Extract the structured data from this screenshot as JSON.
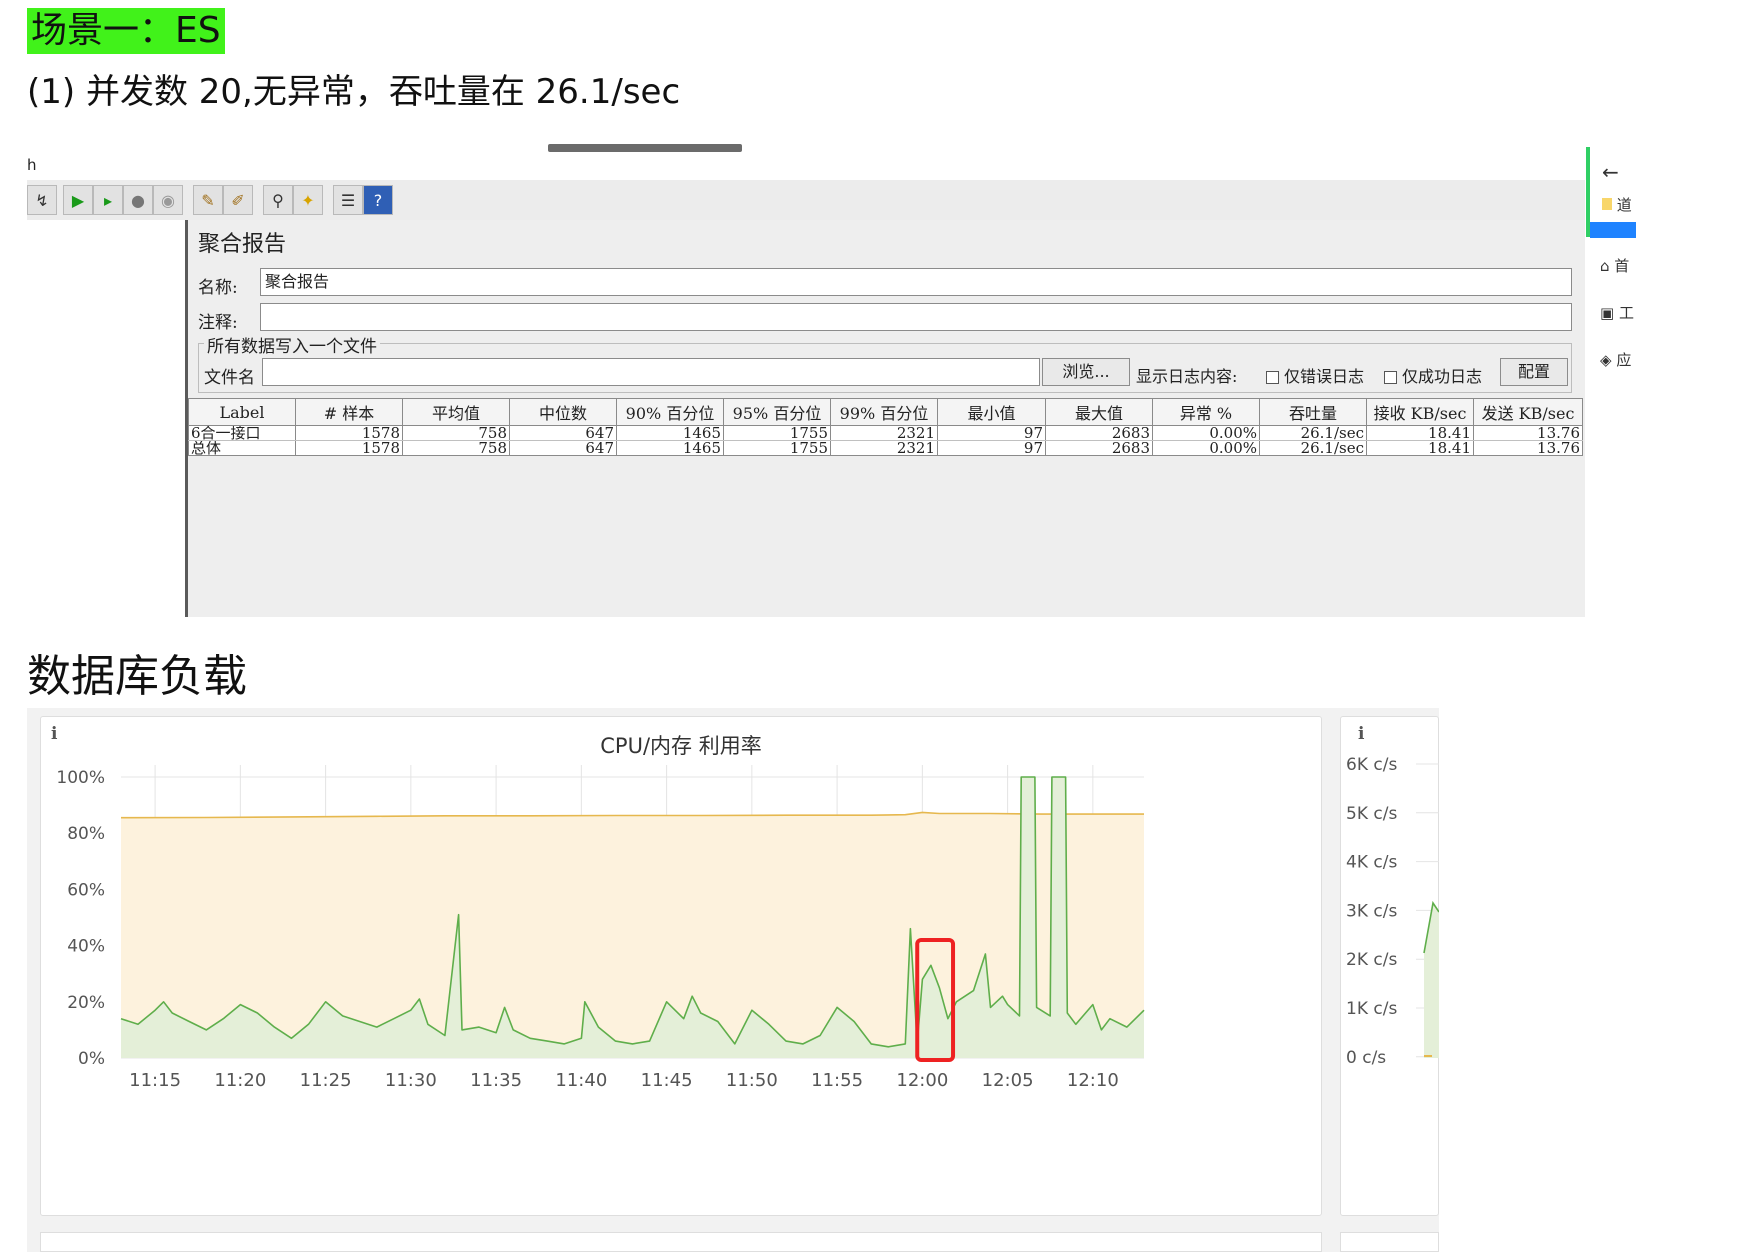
{
  "doc": {
    "scene_title": "场景一：ES",
    "subline": "(1)    并发数 20,无异常，吞吐量在 26.1/sec",
    "db_section_title": "数据库负载"
  },
  "jmeter": {
    "window_title_fragment": "h",
    "toolbar_icons": [
      "remote-start-icon",
      "start-icon",
      "start-no-pause-icon",
      "stop-icon",
      "shutdown-icon",
      "clear-icon",
      "clear-all-icon",
      "search-icon",
      "reset-search-icon",
      "function-helper-icon",
      "help-icon"
    ],
    "panel_title": "聚合报告",
    "name_label": "名称:",
    "name_value": "聚合报告",
    "comment_label": "注释:",
    "comment_value": "",
    "file_group_legend": "所有数据写入一个文件",
    "filename_label": "文件名",
    "filename_value": "",
    "browse_button": "浏览...",
    "log_display_label": "显示日志内容:",
    "errors_only_label": "仅错误日志",
    "success_only_label": "仅成功日志",
    "config_button": "配置",
    "errors_only_checked": false,
    "success_only_checked": false,
    "table": {
      "headers": [
        "Label",
        "# 样本",
        "平均值",
        "中位数",
        "90% 百分位",
        "95% 百分位",
        "99% 百分位",
        "最小值",
        "最大值",
        "异常 %",
        "吞吐量",
        "接收 KB/sec",
        "发送 KB/sec"
      ],
      "rows": [
        [
          "6合一接口",
          "1578",
          "758",
          "647",
          "1465",
          "1755",
          "2321",
          "97",
          "2683",
          "0.00%",
          "26.1/sec",
          "18.41",
          "13.76"
        ],
        [
          "总体",
          "1578",
          "758",
          "647",
          "1465",
          "1755",
          "2321",
          "97",
          "2683",
          "0.00%",
          "26.1/sec",
          "18.41",
          "13.76"
        ]
      ]
    }
  },
  "browser_side": {
    "items": [
      {
        "icon": "back-arrow-icon",
        "label": "←"
      },
      {
        "icon": "note-icon",
        "label": "道"
      },
      {
        "icon": "home-icon",
        "label": "首"
      },
      {
        "icon": "tool-icon",
        "label": "工"
      },
      {
        "icon": "app-icon",
        "label": "应"
      }
    ],
    "accent_green": "#2fcf64",
    "accent_blue": "#1f83ff"
  },
  "grafana": {
    "info_glyph": "i",
    "panel_right_ticks": [
      "6K c/s",
      "5K c/s",
      "4K c/s",
      "3K c/s",
      "2K c/s",
      "1K c/s",
      "0 c/s"
    ]
  },
  "chart_data": {
    "type": "area",
    "title": "CPU/内存 利用率",
    "xlabel": "",
    "ylabel": "",
    "ylim": [
      0,
      100
    ],
    "y_ticks": [
      "100%",
      "80%",
      "60%",
      "40%",
      "20%",
      "0%"
    ],
    "x_ticks": [
      "11:15",
      "11:20",
      "11:25",
      "11:30",
      "11:35",
      "11:40",
      "11:45",
      "11:50",
      "11:55",
      "12:00",
      "12:05",
      "12:10"
    ],
    "x_range": [
      "11:13",
      "12:13"
    ],
    "grid": true,
    "legend": "none",
    "highlight_box": {
      "from": "11:59.7",
      "to": "12:01.8",
      "color": "#ee2222"
    },
    "series": [
      {
        "color": "#e6b84e",
        "fill": "#fdf2dd",
        "points": [
          [
            "11:13",
            85.5
          ],
          [
            "11:18",
            85.6
          ],
          [
            "11:23",
            85.8
          ],
          [
            "11:28",
            86.0
          ],
          [
            "11:32",
            86.2
          ],
          [
            "11:37",
            86.2
          ],
          [
            "11:42",
            86.3
          ],
          [
            "11:47",
            86.3
          ],
          [
            "11:52",
            86.4
          ],
          [
            "11:57",
            86.4
          ],
          [
            "11:59",
            86.6
          ],
          [
            "12:00",
            87.4
          ],
          [
            "12:01",
            87.0
          ],
          [
            "12:04",
            87.0
          ],
          [
            "12:07",
            86.8
          ],
          [
            "12:13",
            86.8
          ]
        ]
      },
      {
        "color": "#5fae4b",
        "fill": "#e4efd8",
        "points": [
          [
            "11:13",
            14
          ],
          [
            "11:14",
            12
          ],
          [
            "11:15",
            17
          ],
          [
            "11:15.5",
            20
          ],
          [
            "11:16",
            16
          ],
          [
            "11:17",
            13
          ],
          [
            "11:18",
            10
          ],
          [
            "11:19",
            14
          ],
          [
            "11:20",
            19
          ],
          [
            "11:21",
            16
          ],
          [
            "11:22",
            11
          ],
          [
            "11:23",
            7
          ],
          [
            "11:24",
            12
          ],
          [
            "11:25",
            20
          ],
          [
            "11:26",
            15
          ],
          [
            "11:27",
            13
          ],
          [
            "11:28",
            11
          ],
          [
            "11:29",
            14
          ],
          [
            "11:30",
            17
          ],
          [
            "11:30.5",
            21
          ],
          [
            "11:31",
            12
          ],
          [
            "11:32",
            8
          ],
          [
            "11:32.8",
            51
          ],
          [
            "11:33",
            10
          ],
          [
            "11:34",
            11
          ],
          [
            "11:35",
            9
          ],
          [
            "11:35.5",
            18
          ],
          [
            "11:36",
            10
          ],
          [
            "11:37",
            7
          ],
          [
            "11:38",
            6
          ],
          [
            "11:39",
            5
          ],
          [
            "11:40",
            7
          ],
          [
            "11:40.2",
            20
          ],
          [
            "11:41",
            11
          ],
          [
            "11:42",
            6
          ],
          [
            "11:43",
            5
          ],
          [
            "11:44",
            6
          ],
          [
            "11:45",
            20
          ],
          [
            "11:46",
            14
          ],
          [
            "11:46.5",
            22
          ],
          [
            "11:47",
            16
          ],
          [
            "11:48",
            13
          ],
          [
            "11:49",
            5
          ],
          [
            "11:50",
            17
          ],
          [
            "11:51",
            12
          ],
          [
            "11:52",
            6
          ],
          [
            "11:53",
            5
          ],
          [
            "11:54",
            8
          ],
          [
            "11:55",
            18
          ],
          [
            "11:56",
            13
          ],
          [
            "11:57",
            5
          ],
          [
            "11:58",
            4
          ],
          [
            "11:59",
            5
          ],
          [
            "11:59.3",
            46
          ],
          [
            "11:59.7",
            5
          ],
          [
            "12:00",
            28
          ],
          [
            "12:00.5",
            33
          ],
          [
            "12:01",
            25
          ],
          [
            "12:01.5",
            14
          ],
          [
            "12:02",
            20
          ],
          [
            "12:03",
            24
          ],
          [
            "12:03.7",
            37
          ],
          [
            "12:04",
            18
          ],
          [
            "12:04.7",
            22
          ],
          [
            "12:05",
            19
          ],
          [
            "12:05.7",
            15
          ],
          [
            "12:05.8",
            100
          ],
          [
            "12:06.6",
            100
          ],
          [
            "12:06.7",
            18
          ],
          [
            "12:07.5",
            15
          ],
          [
            "12:07.6",
            100
          ],
          [
            "12:08.4",
            100
          ],
          [
            "12:08.5",
            16
          ],
          [
            "12:09",
            12
          ],
          [
            "12:10",
            19
          ],
          [
            "12:10.5",
            10
          ],
          [
            "12:11",
            14
          ],
          [
            "12:12",
            11
          ],
          [
            "12:13",
            17
          ]
        ]
      }
    ]
  }
}
